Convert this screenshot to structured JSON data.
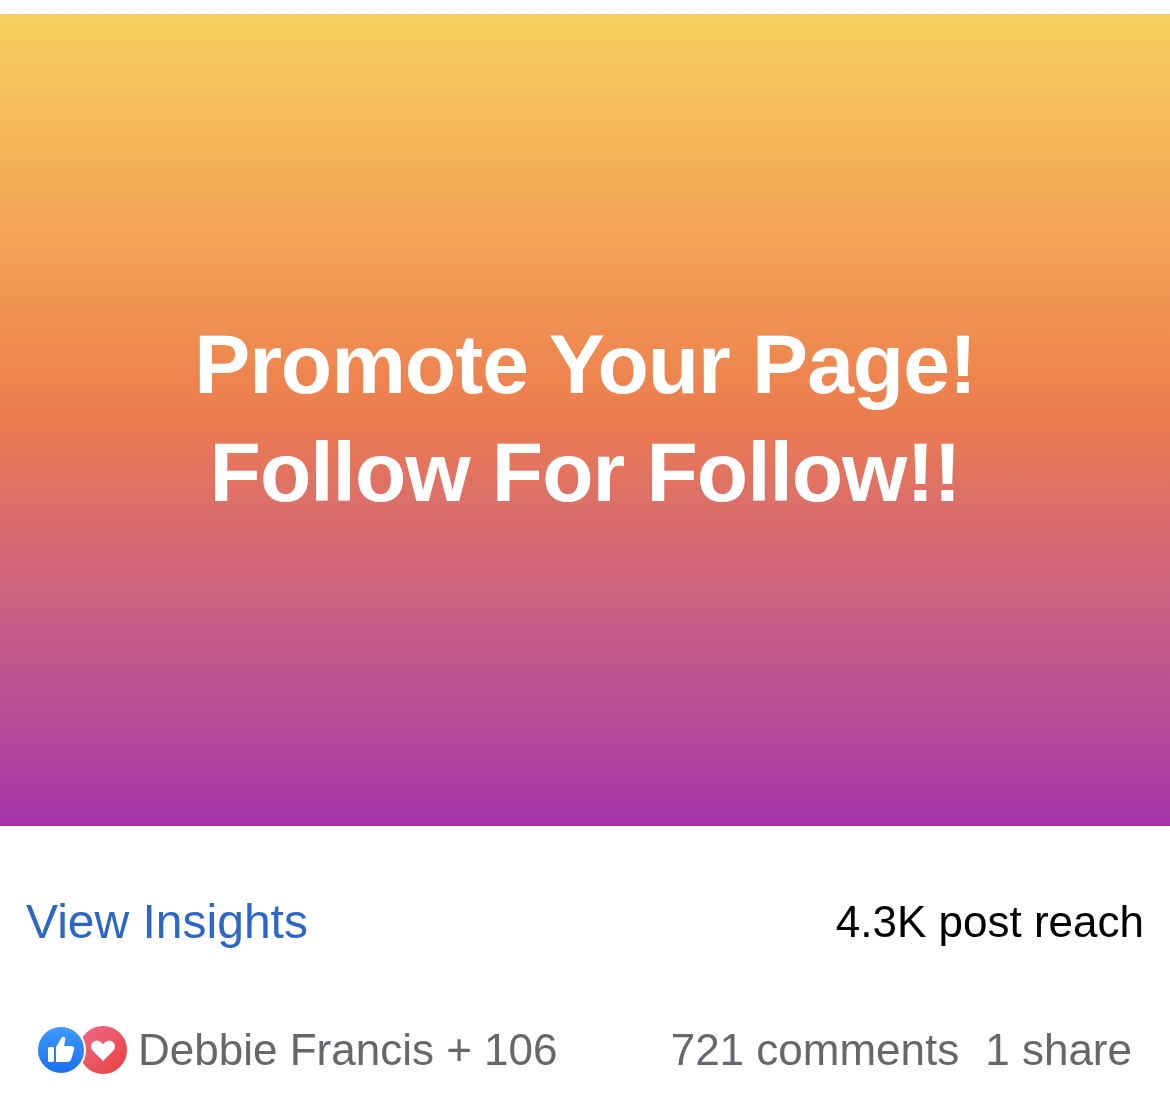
{
  "post_banner": {
    "lines": [
      "Promote Your Page!",
      "Follow For Follow!!"
    ]
  },
  "insights": {
    "link": "View Insights",
    "reach": "4.3K post reach"
  },
  "engagement": {
    "reactions": [
      {
        "kind": "like"
      },
      {
        "kind": "love"
      }
    ],
    "reactors": "Debbie Francis + 106",
    "comments": "721 comments",
    "shares": "1 share"
  }
}
